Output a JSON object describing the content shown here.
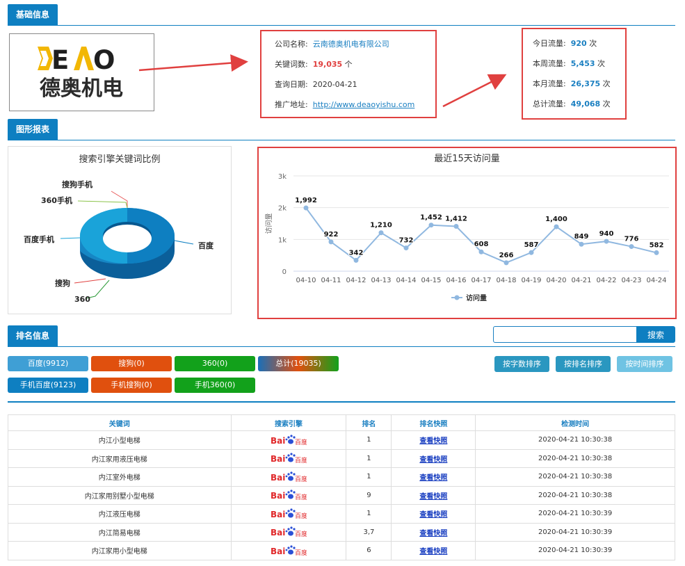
{
  "sections": {
    "basic": "基础信息",
    "charts": "图形报表",
    "ranking": "排名信息"
  },
  "logo": {
    "text_top": "DEAO",
    "text_bottom": "德奥机电"
  },
  "company": {
    "name_label": "公司名称:",
    "name_value": "云南德奥机电有限公司",
    "keywords_label": "关键词数:",
    "keywords_value": "19,035",
    "keywords_unit": "个",
    "date_label": "查询日期:",
    "date_value": "2020-04-21",
    "url_label": "推广地址:",
    "url_value": "http://www.deaoyishu.com"
  },
  "traffic": [
    {
      "label": "今日流量:",
      "value": "920",
      "unit": "次"
    },
    {
      "label": "本周流量:",
      "value": "5,453",
      "unit": "次"
    },
    {
      "label": "本月流量:",
      "value": "26,375",
      "unit": "次"
    },
    {
      "label": "总计流量:",
      "value": "49,068",
      "unit": "次"
    }
  ],
  "chart_data": [
    {
      "type": "pie",
      "title": "搜索引擎关键词比例",
      "categories": [
        "百度",
        "搜狗",
        "360",
        "百度手机",
        "360手机",
        "搜狗手机"
      ],
      "values": [
        9912,
        0,
        0,
        9123,
        0,
        0
      ],
      "colors": [
        "#0e7fc1",
        "#e0403f",
        "#2e9b3a",
        "#1aa3d9",
        "#8bc34a",
        "#e85b5b"
      ]
    },
    {
      "type": "line",
      "title": "最近15天访问量",
      "ylabel": "访问量",
      "categories": [
        "04-10",
        "04-11",
        "04-12",
        "04-13",
        "04-14",
        "04-15",
        "04-16",
        "04-17",
        "04-18",
        "04-19",
        "04-20",
        "04-21",
        "04-22",
        "04-23",
        "04-24"
      ],
      "series": [
        {
          "name": "访问量",
          "values": [
            1992,
            922,
            342,
            1210,
            732,
            1452,
            1412,
            608,
            266,
            587,
            1400,
            849,
            940,
            776,
            582
          ]
        }
      ],
      "ylim": [
        0,
        3000
      ],
      "yticks": [
        "0",
        "1k",
        "2k",
        "3k"
      ],
      "data_labels": [
        "1,992",
        "922",
        "342",
        "1,210",
        "732",
        "1,452",
        "1,412",
        "608",
        "266",
        "587",
        "1,400",
        "849",
        "940",
        "776",
        "582"
      ],
      "line_color": "#90b8e0"
    }
  ],
  "search": {
    "placeholder": "",
    "button": "搜索"
  },
  "engine_chips": [
    {
      "label": "百度(9912)",
      "color": "#3f9fd5"
    },
    {
      "label": "搜狗(0)",
      "color": "#e0500e"
    },
    {
      "label": "360(0)",
      "color": "#12a11b"
    },
    {
      "label": "总计(19035)",
      "color": "gradient"
    },
    {
      "label": "手机百度(9123)",
      "color": "#0e7fc1"
    },
    {
      "label": "手机搜狗(0)",
      "color": "#e0500e"
    },
    {
      "label": "手机360(0)",
      "color": "#12a11b"
    }
  ],
  "sort_buttons": [
    {
      "label": "按字数排序",
      "color": "#2a97c0"
    },
    {
      "label": "按排名排序",
      "color": "#2a97c0"
    },
    {
      "label": "按时间排序",
      "color": "#6fc3e3"
    }
  ],
  "table": {
    "headers": [
      "关键词",
      "搜索引擎",
      "排名",
      "排名快照",
      "检测时间"
    ],
    "snapshot_text": "查看快照",
    "engine_text": "百度",
    "rows": [
      {
        "keyword": "内江小型电梯",
        "rank": "1",
        "time": "2020-04-21 10:30:38"
      },
      {
        "keyword": "内江家用液压电梯",
        "rank": "1",
        "time": "2020-04-21 10:30:38"
      },
      {
        "keyword": "内江室外电梯",
        "rank": "1",
        "time": "2020-04-21 10:30:38"
      },
      {
        "keyword": "内江家用别墅小型电梯",
        "rank": "9",
        "time": "2020-04-21 10:30:38"
      },
      {
        "keyword": "内江液压电梯",
        "rank": "1",
        "time": "2020-04-21 10:30:39"
      },
      {
        "keyword": "内江简易电梯",
        "rank": "3,7",
        "time": "2020-04-21 10:30:39"
      },
      {
        "keyword": "内江家用小型电梯",
        "rank": "6",
        "time": "2020-04-21 10:30:39"
      }
    ]
  }
}
